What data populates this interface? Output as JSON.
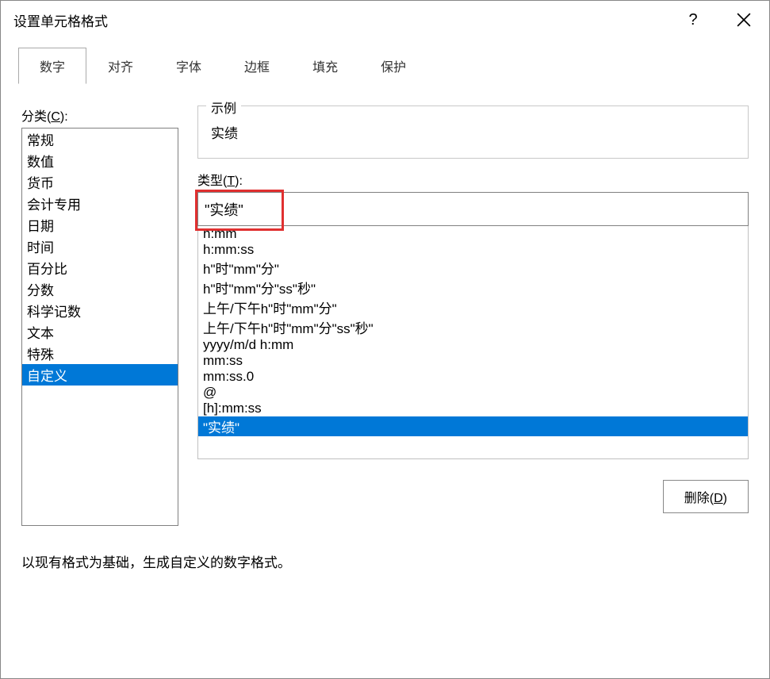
{
  "dialog": {
    "title": "设置单元格格式"
  },
  "tabs": {
    "number": "数字",
    "alignment": "对齐",
    "font": "字体",
    "border": "边框",
    "fill": "填充",
    "protection": "保护"
  },
  "category": {
    "label_prefix": "分类(",
    "label_key": "C",
    "label_suffix": "):",
    "items": [
      "常规",
      "数值",
      "货币",
      "会计专用",
      "日期",
      "时间",
      "百分比",
      "分数",
      "科学记数",
      "文本",
      "特殊",
      "自定义"
    ],
    "selected_index": 11
  },
  "sample": {
    "legend": "示例",
    "value": "实绩"
  },
  "type": {
    "label_prefix": "类型(",
    "label_key": "T",
    "label_suffix": "):",
    "input_value": "\"实绩\"",
    "items": [
      "h:mm",
      "h:mm:ss",
      "h\"时\"mm\"分\"",
      "h\"时\"mm\"分\"ss\"秒\"",
      "上午/下午h\"时\"mm\"分\"",
      "上午/下午h\"时\"mm\"分\"ss\"秒\"",
      "yyyy/m/d h:mm",
      "mm:ss",
      "mm:ss.0",
      "@",
      "[h]:mm:ss",
      "\"实绩\""
    ],
    "selected_index": 11
  },
  "delete": {
    "label_prefix": "删除(",
    "label_key": "D",
    "label_suffix": ")"
  },
  "footer": {
    "text": "以现有格式为基础，生成自定义的数字格式。"
  }
}
